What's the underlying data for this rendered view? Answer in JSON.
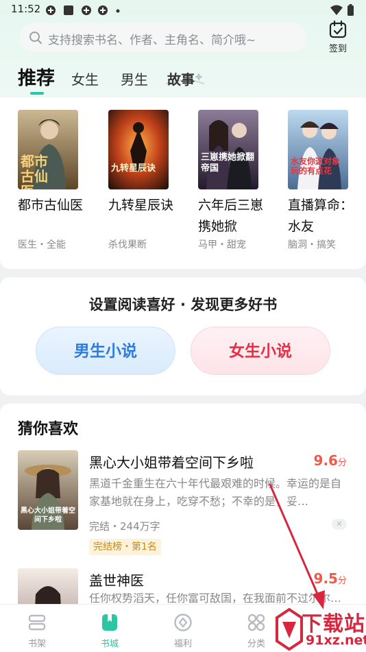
{
  "status_bar": {
    "time": "11:52"
  },
  "search": {
    "placeholder": "支持搜索书名、作者、主角名、简介哦~"
  },
  "checkin": {
    "label": "签到"
  },
  "tabs": [
    {
      "label": "推荐",
      "active": true
    },
    {
      "label": "女生"
    },
    {
      "label": "男生"
    },
    {
      "label": "故事"
    }
  ],
  "recommend_books": [
    {
      "title": "都市古仙医",
      "tags": "医生・全能",
      "cover_text": "都市古仙医",
      "cover_colors": [
        "#c9b48a",
        "#6b4f2a"
      ]
    },
    {
      "title": "九转星辰诀",
      "tags": "杀伐果断",
      "cover_text": "九转星辰诀",
      "cover_colors": [
        "#e0702a",
        "#3a1a0e"
      ]
    },
    {
      "title": "六年后三崽携她掀",
      "tags": "马甲・甜宠",
      "cover_text": "三崽携她掀翻帝国",
      "cover_colors": [
        "#7b6a8a",
        "#2a1f33"
      ]
    },
    {
      "title": "直播算命：水友",
      "tags": "脑洞・搞笑",
      "cover_text": "水友你这对象玩的有点花",
      "cover_colors": [
        "#9ec7e8",
        "#3b5a86"
      ]
    }
  ],
  "preference": {
    "title": "设置阅读喜好 · 发现更多好书",
    "male_label": "男生小说",
    "female_label": "女生小说"
  },
  "guess": {
    "title": "猜你喜欢",
    "items": [
      {
        "title": "黑心大小姐带着空间下乡啦",
        "score": "9.6",
        "score_unit": "分",
        "desc": "黑道千金重生在六十年代最艰难的时候。幸运的是自家基地就在身上，吃穿不愁；不幸的是，妥…",
        "meta": "完结・244万字",
        "badge": "完结榜・第1名",
        "cover_text": "黑心大小姐带着空间下乡啦",
        "cover_colors": [
          "#c7b9a3",
          "#5d4a3a"
        ]
      },
      {
        "title": "盖世神医",
        "score": "9.5",
        "score_unit": "分",
        "desc": "任你权势滔天，任你富可敌国，在我面前不过尔尔…",
        "cover_colors": [
          "#efe6de",
          "#6e5a58"
        ]
      }
    ]
  },
  "bottom_nav": [
    {
      "label": "书架",
      "icon": "bookshelf-icon"
    },
    {
      "label": "书城",
      "icon": "bookstore-icon",
      "active": true
    },
    {
      "label": "福利",
      "icon": "welfare-icon"
    },
    {
      "label": "分类",
      "icon": "category-icon"
    }
  ],
  "watermark": {
    "big": "下载站",
    "small": "91xz.net"
  },
  "colors": {
    "accent": "#2bc7a3",
    "score": "#f05a4b",
    "male": "#2e7be0",
    "female": "#e52f48",
    "annotation": "#d7263d"
  }
}
